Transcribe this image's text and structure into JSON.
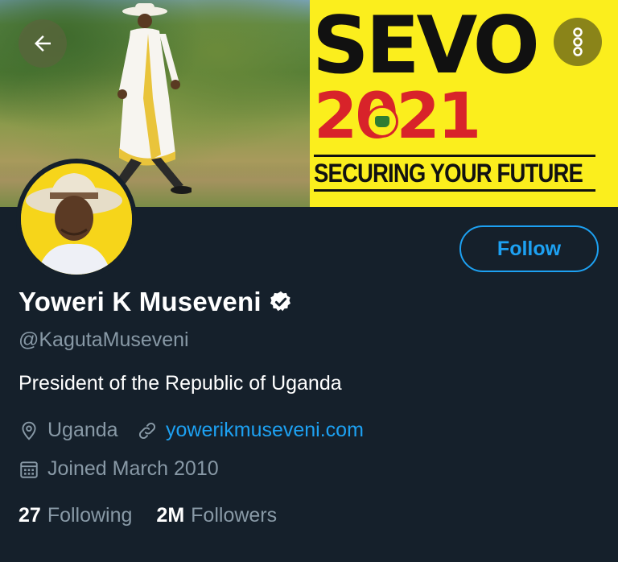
{
  "banner": {
    "headline": "SEVO",
    "year": "2021",
    "tagline": "SECURING YOUR FUTURE"
  },
  "nav": {
    "back_icon": "arrow-left-icon",
    "more_icon": "more-vertical-icon"
  },
  "profile": {
    "display_name": "Yoweri K Museveni",
    "verified_icon": "verified-badge-icon",
    "handle": "@KagutaMuseveni",
    "bio": "President of the Republic of Uganda",
    "location": "Uganda",
    "website": "yowerikmuseveni.com",
    "joined": "Joined March 2010",
    "follow_label": "Follow"
  },
  "stats": {
    "following_count": "27",
    "following_label": "Following",
    "followers_count": "2M",
    "followers_label": "Followers"
  },
  "colors": {
    "background": "#15202b",
    "accent": "#1da1f2",
    "secondary_text": "#8899a6",
    "banner_yellow": "#fbee1d",
    "banner_red": "#d8232a"
  }
}
